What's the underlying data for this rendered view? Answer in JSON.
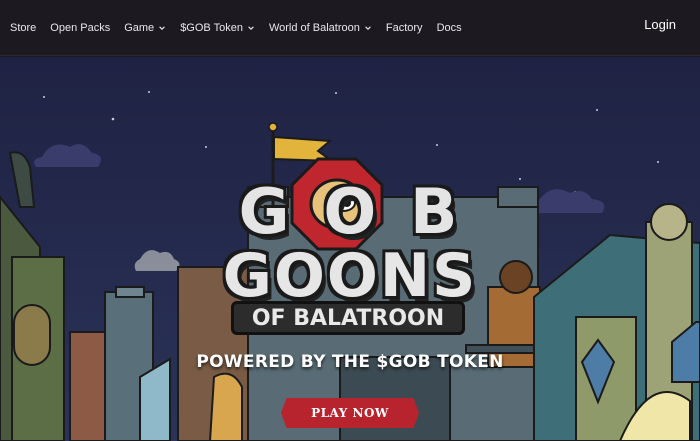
{
  "nav": {
    "items": [
      {
        "label": "Store",
        "has_dropdown": false
      },
      {
        "label": "Open Packs",
        "has_dropdown": false
      },
      {
        "label": "Game",
        "has_dropdown": true
      },
      {
        "label": "$GOB Token",
        "has_dropdown": true
      },
      {
        "label": "World of Balatroon",
        "has_dropdown": true
      },
      {
        "label": "Factory",
        "has_dropdown": false
      },
      {
        "label": "Docs",
        "has_dropdown": false
      }
    ],
    "login_label": "Login"
  },
  "hero": {
    "logo_line1": "GOB",
    "logo_line2": "GOONS",
    "logo_line3": "OF BALATROON",
    "powered_text": "POWERED BY THE $GOB TOKEN",
    "cta_label": "PLAY NOW"
  },
  "colors": {
    "nav_bg": "#1c1a20",
    "sky": "#23284a",
    "cta": "#b8242e",
    "logo_ring": "#c0262d"
  }
}
